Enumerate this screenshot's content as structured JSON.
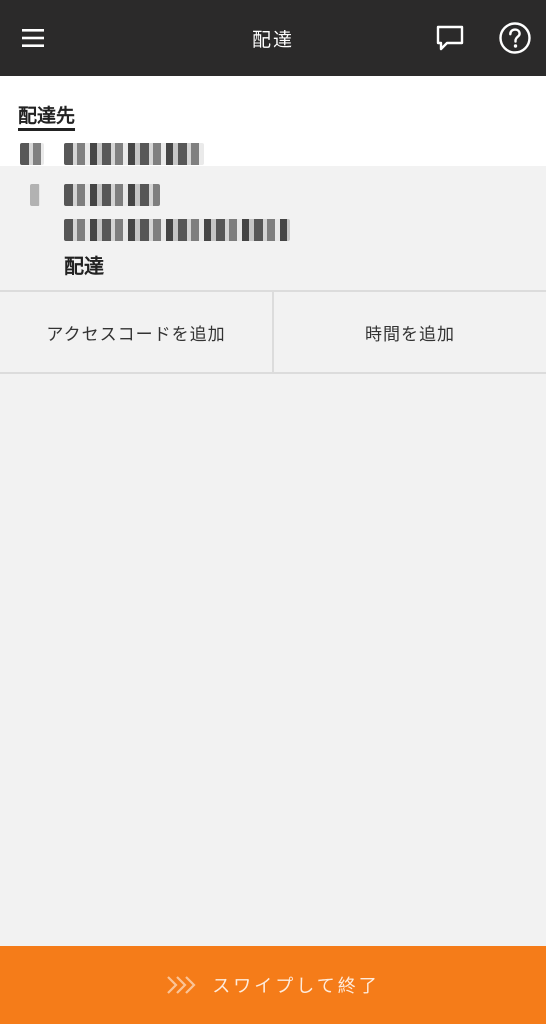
{
  "header": {
    "title": "配達",
    "menu_icon": "menu-icon",
    "chat_icon": "chat-bubble-icon",
    "help_icon": "help-circle-icon"
  },
  "destination": {
    "section_label": "配達先",
    "delivery_type": "配達"
  },
  "actions": {
    "add_access_code": "アクセスコードを追加",
    "add_time": "時間を追加"
  },
  "swipe": {
    "icon": "triple-chevron-right-icon",
    "label": "スワイプして終了"
  },
  "colors": {
    "header_bg": "#2b2a2a",
    "accent": "#f57c19",
    "page_bg": "#f2f2f2"
  }
}
